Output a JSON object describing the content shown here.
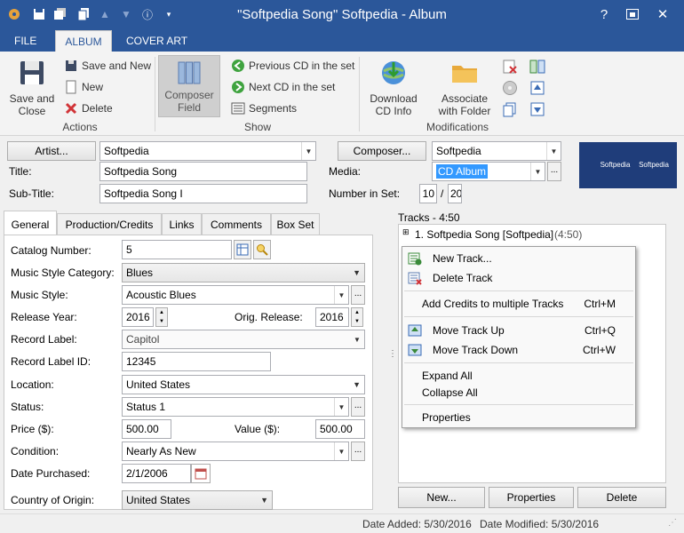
{
  "window": {
    "title": "\"Softpedia Song\" Softpedia - Album",
    "accent": "#2b579a"
  },
  "quick_access": [
    "save-icon",
    "save-all-icon",
    "copy-icon",
    "up-arrow-icon",
    "down-arrow-icon",
    "info-icon",
    "dropdown-icon"
  ],
  "window_controls": [
    "?",
    "restore-icon",
    "×"
  ],
  "ribbon_tabs": [
    "FILE",
    "ALBUM",
    "COVER ART"
  ],
  "ribbon": {
    "actions": {
      "save_close": "Save and\nClose",
      "save_new": "Save and New",
      "new": "New",
      "delete": "Delete",
      "label": "Actions"
    },
    "show": {
      "composer_field": "Composer\nField",
      "previous_cd": "Previous CD in the set",
      "next_cd": "Next CD in the set",
      "segments": "Segments",
      "label": "Show"
    },
    "modifications": {
      "download": "Download\nCD Info",
      "associate": "Associate\nwith Folder",
      "label": "Modifications"
    }
  },
  "header_fields": {
    "artist_btn": "Artist...",
    "artist": "Softpedia",
    "composer_btn": "Composer...",
    "composer": "Softpedia",
    "title_label": "Title:",
    "title": "Softpedia Song",
    "media_label": "Media:",
    "media": "CD Album",
    "subtitle_label": "Sub-Title:",
    "subtitle": "Softpedia Song I",
    "number_label": "Number in Set:",
    "number": "10",
    "number_sep": "/",
    "number_total": "20",
    "thumb1": "Softpedia",
    "thumb2": "Softpedia"
  },
  "panel_tabs": [
    "General",
    "Production/Credits",
    "Links",
    "Comments",
    "Box Set"
  ],
  "general": {
    "catalog_label": "Catalog Number:",
    "catalog": "5",
    "style_cat_label": "Music Style Category:",
    "style_cat": "Blues",
    "style_label": "Music Style:",
    "style": "Acoustic Blues",
    "release_label": "Release Year:",
    "release": "2016",
    "orig_label": "Orig. Release:",
    "orig": "2016",
    "record_label_label": "Record Label:",
    "record_label": "Capitol",
    "record_id_label": "Record Label ID:",
    "record_id": "12345",
    "location_label": "Location:",
    "location": "United States",
    "status_label": "Status:",
    "status": "Status 1",
    "price_label": "Price ($):",
    "price": "500.00",
    "value_label": "Value ($):",
    "value": "500.00",
    "condition_label": "Condition:",
    "condition": "Nearly As New",
    "date_label": "Date Purchased:",
    "date": "2/1/2006",
    "country_label": "Country of Origin:",
    "country": "United States"
  },
  "tracks": {
    "header": "Tracks - 4:50",
    "item": "1. Softpedia Song [Softpedia]",
    "duration": "(4:50)"
  },
  "context_menu": {
    "new_track": "New Track...",
    "delete_track": "Delete Track",
    "add_credits": "Add Credits to multiple Tracks",
    "add_credits_sc": "Ctrl+M",
    "move_up": "Move Track Up",
    "move_up_sc": "Ctrl+Q",
    "move_down": "Move Track Down",
    "move_down_sc": "Ctrl+W",
    "expand_all": "Expand All",
    "collapse_all": "Collapse All",
    "properties": "Properties"
  },
  "track_buttons": {
    "new": "New...",
    "properties": "Properties",
    "delete": "Delete"
  },
  "status_bar": {
    "added": "Date Added: 5/30/2016",
    "modified": "Date Modified: 5/30/2016"
  }
}
